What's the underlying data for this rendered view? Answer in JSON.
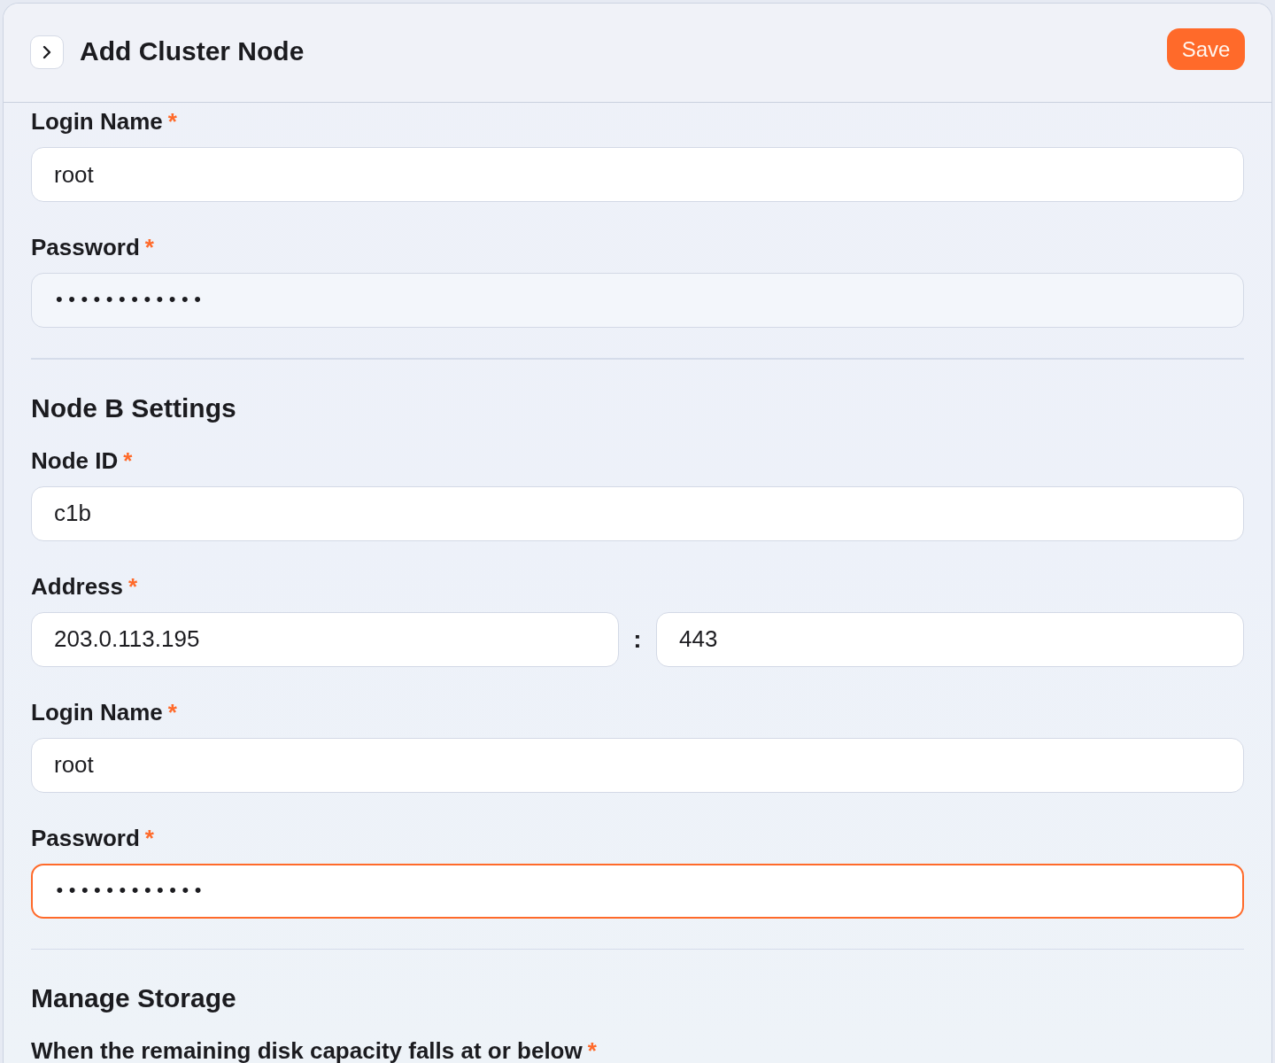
{
  "header": {
    "title": "Add Cluster Node",
    "save_button": "Save"
  },
  "sections": [
    {
      "fields": [
        {
          "kind": "text",
          "label": "Login Name",
          "required_mark": "*",
          "value": "root",
          "focused": false,
          "hovered": false
        },
        {
          "kind": "password",
          "label": "Password",
          "required_mark": "*",
          "value": "••••••••••••",
          "focused": false,
          "hovered": true
        }
      ]
    },
    {
      "heading": "Node B Settings",
      "fields": [
        {
          "kind": "text",
          "label": "Node ID",
          "required_mark": "*",
          "value": "c1b",
          "focused": false,
          "hovered": false
        },
        {
          "kind": "address",
          "label": "Address",
          "required_mark": "*",
          "separator": ":",
          "inputs": [
            {
              "value": "203.0.113.195",
              "focused": false,
              "hovered": false
            },
            {
              "value": "443",
              "focused": false,
              "hovered": false
            }
          ]
        },
        {
          "kind": "text",
          "label": "Login Name",
          "required_mark": "*",
          "value": "root",
          "focused": false,
          "hovered": false
        },
        {
          "kind": "password",
          "label": "Password",
          "required_mark": "*",
          "value": "••••••••••••",
          "focused": true,
          "hovered": false
        }
      ]
    },
    {
      "heading": "Manage Storage",
      "fields": [
        {
          "kind": "label",
          "label": "When the remaining disk capacity falls at or below",
          "required_mark": "*"
        }
      ]
    }
  ]
}
